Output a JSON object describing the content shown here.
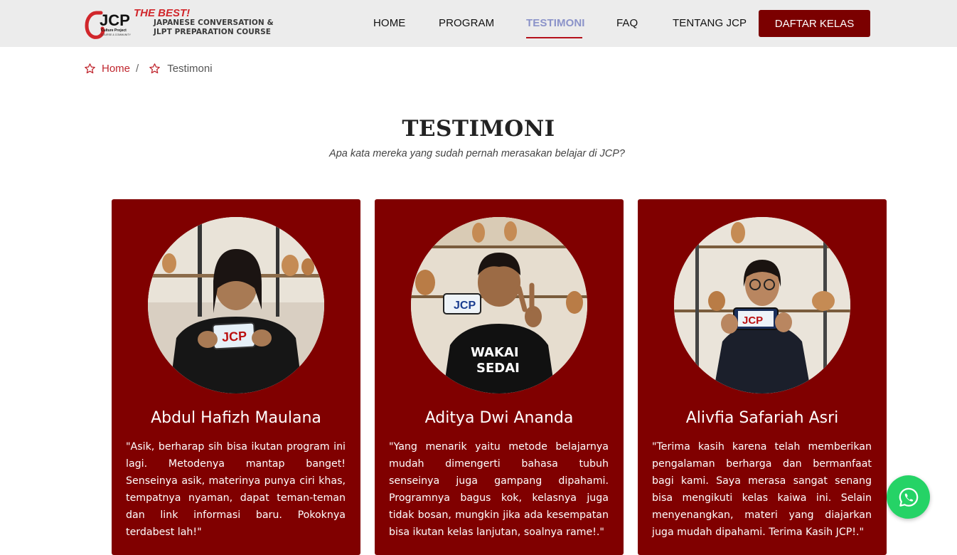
{
  "brand": {
    "logo_text": "JCP",
    "tagline": "THE BEST!",
    "line1": "JAPANESE CONVERSATION &",
    "line2": "JLPT PREPARATION COURSE",
    "accent_color": "#7b0000",
    "nav_active_color": "#8b93c9"
  },
  "nav": {
    "items": [
      {
        "label": "HOME"
      },
      {
        "label": "PROGRAM"
      },
      {
        "label": "TESTIMONI"
      },
      {
        "label": "FAQ"
      },
      {
        "label": "TENTANG JCP"
      }
    ],
    "active": "TESTIMONI",
    "cta_label": "DAFTAR KELAS"
  },
  "breadcrumb": {
    "home": "Home",
    "separator": "/",
    "current": "Testimoni"
  },
  "section": {
    "title": "TESTIMONI",
    "subtitle": "Apa kata mereka yang sudah pernah merasakan belajar di JCP?"
  },
  "testimonials": [
    {
      "name": "Abdul Hafizh Maulana",
      "quote": "\"Asik, berharap sih bisa ikutan program ini lagi. Metodenya mantap banget! Senseinya asik, materinya punya ciri khas, tempatnya nyaman, dapat teman-teman dan link informasi baru. Pokoknya terdabest lah!\""
    },
    {
      "name": "Aditya Dwi Ananda",
      "quote": "\"Yang menarik yaitu metode belajarnya mudah dimengerti bahasa tubuh senseinya juga gampang dipahami. Programnya bagus kok, kelasnya juga tidak bosan, mungkin jika ada kesempatan bisa ikutan kelas lanjutan, soalnya rame!.\""
    },
    {
      "name": "Alivfia Safariah Asri",
      "quote": "\"Terima kasih karena telah memberikan pengalaman berharga dan bermanfaat bagi kami. Saya merasa sangat senang bisa mengikuti kelas kaiwa ini. Selain menyenangkan, materi yang diajarkan juga mudah dipahami. Terima Kasih JCP!.\""
    }
  ],
  "shirt_text": {
    "line1": "WAKAI",
    "line2": "SEDAI"
  },
  "whatsapp": {
    "icon": "whatsapp-icon",
    "color": "#25d366"
  }
}
